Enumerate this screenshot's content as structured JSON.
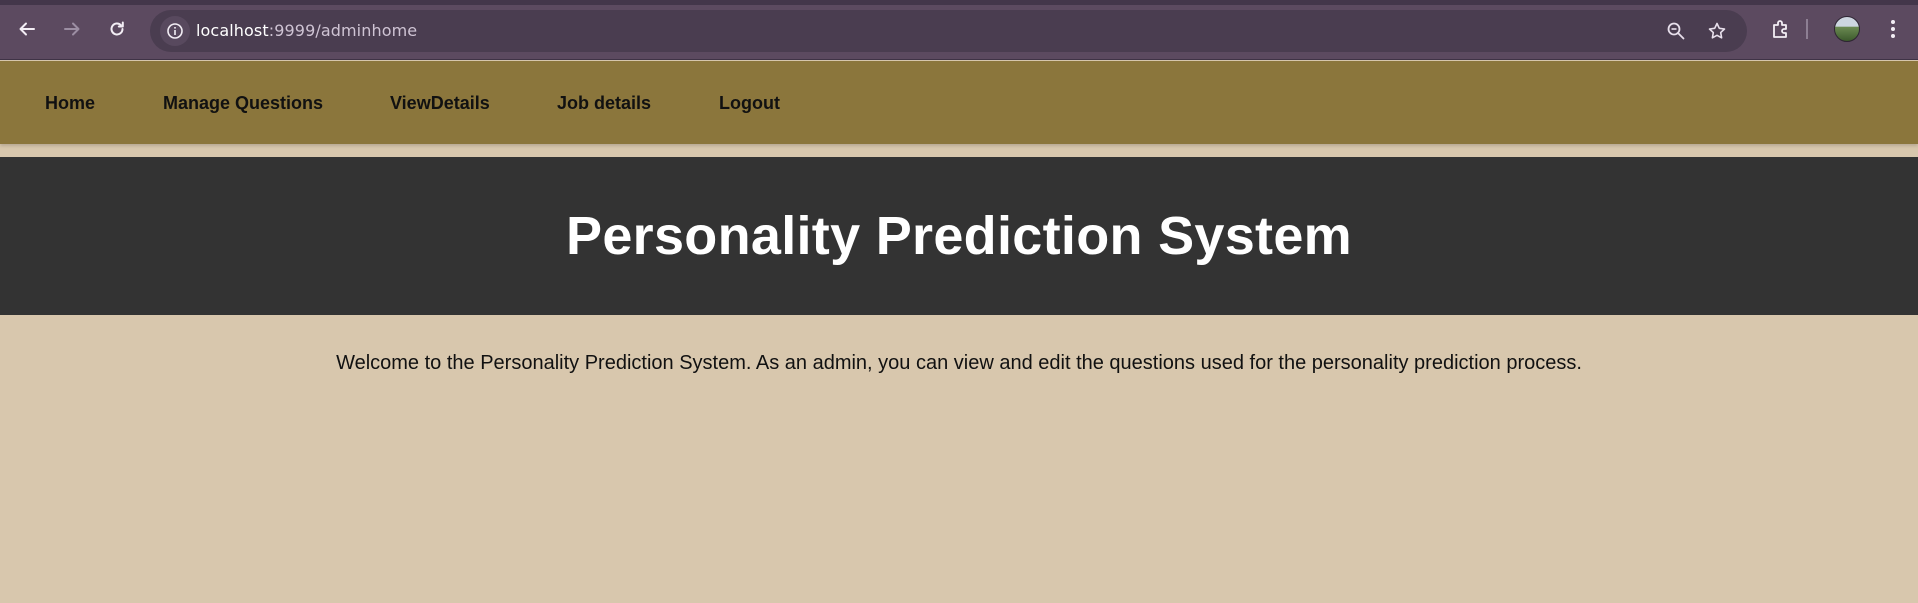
{
  "browser": {
    "url_host": "localhost",
    "url_path": ":9999/adminhome",
    "icons": [
      "back-arrow-icon",
      "forward-arrow-icon",
      "reload-icon",
      "site-info-icon",
      "zoom-out-icon",
      "bookmark-star-icon",
      "extensions-icon",
      "profile-avatar",
      "kebab-menu-icon"
    ]
  },
  "nav": {
    "items": [
      {
        "label": "Home"
      },
      {
        "label": "Manage Questions"
      },
      {
        "label": "ViewDetails"
      },
      {
        "label": "Job details"
      },
      {
        "label": "Logout"
      }
    ]
  },
  "header": {
    "title": "Personality Prediction System"
  },
  "main": {
    "welcome": "Welcome to the Personality Prediction System. As an admin, you can view and edit the questions used for the personality prediction process."
  },
  "colors": {
    "page_bg": "#d8c7ad",
    "nav_bg": "#8b763c",
    "banner_bg": "#333333",
    "browser_chrome": "#5c4a60"
  }
}
